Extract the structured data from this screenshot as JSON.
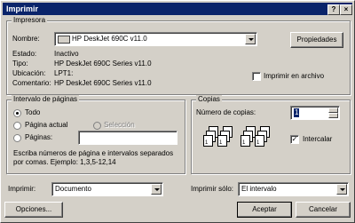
{
  "window": {
    "title": "Imprimir",
    "help_label": "?",
    "close_label": "×"
  },
  "printer": {
    "group_label": "Impresora",
    "name_label": "Nombre:",
    "name_value": "HP DeskJet 690C v11.0",
    "properties_label": "Propiedades",
    "status_label": "Estado:",
    "status_value": "Inactivo",
    "type_label": "Tipo:",
    "type_value": "HP DeskJet 690C Series v11.0",
    "location_label": "Ubicación:",
    "location_value": "LPT1:",
    "comment_label": "Comentario:",
    "comment_value": "HP DeskJet 690C Series v11.0",
    "print_to_file_label": "Imprimir en archivo",
    "print_to_file_checked": false
  },
  "page_range": {
    "group_label": "Intervalo de páginas",
    "all_label": "Todo",
    "current_label": "Página actual",
    "selection_label": "Selección",
    "pages_label": "Páginas:",
    "pages_value": "",
    "selected": "all",
    "hint_line1": "Escriba números de página e intervalos separados",
    "hint_line2": "por comas. Ejemplo: 1,3,5-12,14"
  },
  "copies": {
    "group_label": "Copias",
    "count_label": "Número de copias:",
    "count_value": "1",
    "collate_label": "Intercalar",
    "collate_checked": true,
    "collated_stack": [
      "1",
      "2",
      "3"
    ],
    "uncollated_stack": [
      "1",
      "2",
      "3"
    ]
  },
  "footer": {
    "print_what_label": "Imprimir:",
    "print_what_value": "Documento",
    "print_only_label": "Imprimir sólo:",
    "print_only_value": "El intervalo",
    "options_label": "Opciones...",
    "ok_label": "Aceptar",
    "cancel_label": "Cancelar"
  }
}
